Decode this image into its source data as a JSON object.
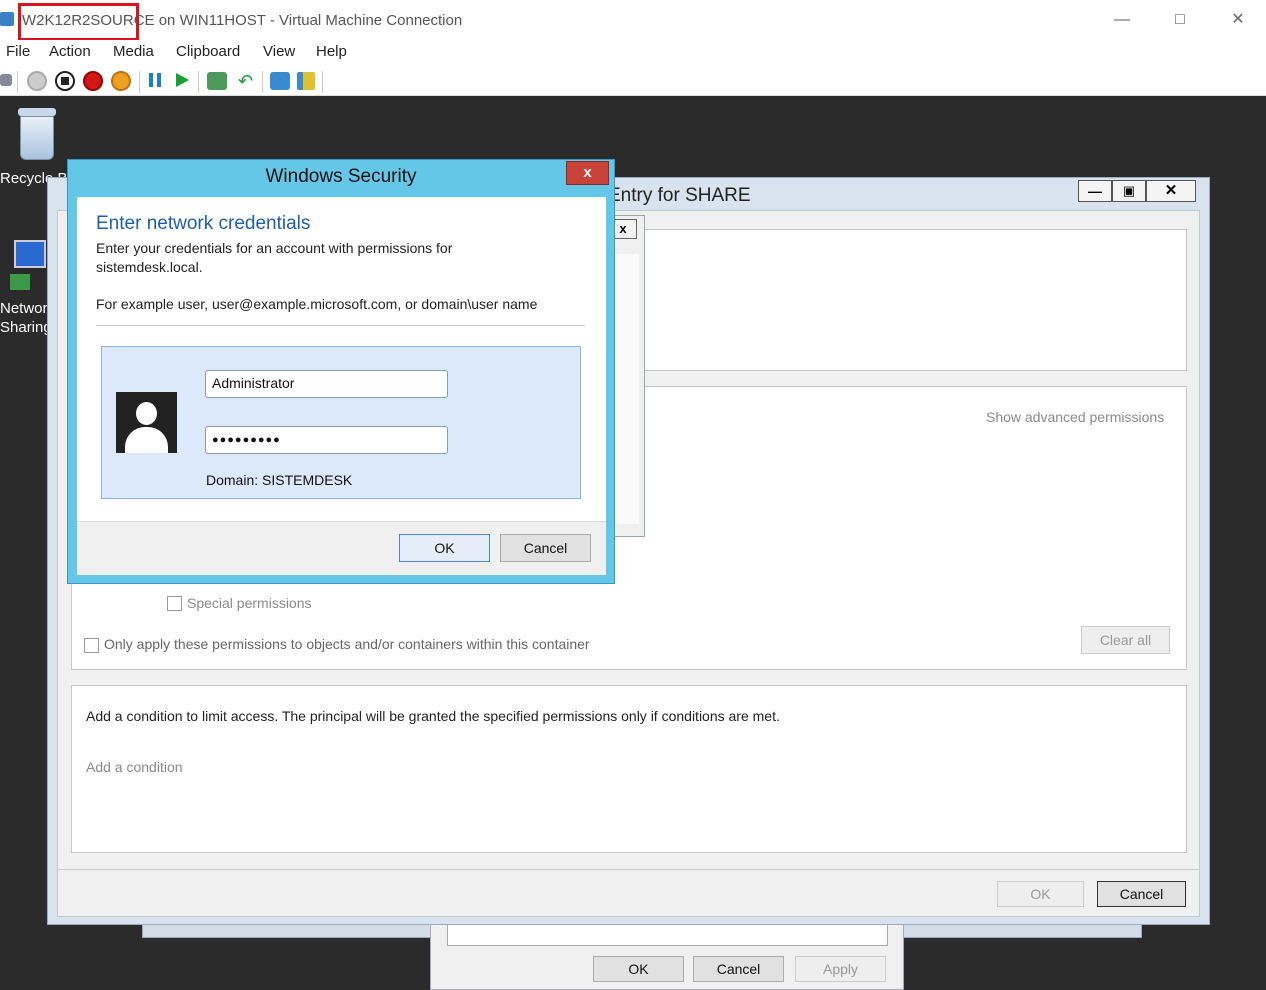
{
  "window": {
    "vm_name": "W2K12R2SOURCE",
    "title_rest": " on WIN11HOST - Virtual Machine Connection"
  },
  "menu": [
    "File",
    "Action",
    "Media",
    "Clipboard",
    "View",
    "Help"
  ],
  "toolbar_icons": [
    "ctrl-alt-del-icon",
    "start-icon",
    "turn-off-icon",
    "shutdown-icon",
    "save-icon",
    "pause-icon",
    "resume-icon",
    "checkpoint-icon",
    "revert-icon",
    "enhanced-session-icon",
    "share-icon"
  ],
  "desktop": {
    "recycle": "Recycle Bi",
    "network_line1": "Network",
    "network_line2": "Sharing"
  },
  "perm": {
    "title": "Entry for SHARE",
    "show_advanced": "Show advanced permissions",
    "special": "Special permissions",
    "only_apply": "Only apply these permissions to objects and/or containers within this container",
    "clear_all": "Clear all",
    "condition_text": "Add a condition to limit access. The principal will be granted the specified permissions only if conditions are met.",
    "add_condition": "Add a condition",
    "ok": "OK",
    "cancel": "Cancel"
  },
  "bottom": {
    "ok": "OK",
    "cancel": "Cancel",
    "apply": "Apply"
  },
  "security": {
    "title": "Windows Security",
    "close": "x",
    "heading": "Enter network credentials",
    "desc1": "Enter your credentials for an account with permissions for",
    "desc2": "sistemdesk.local.",
    "example": "For example user, user@example.microsoft.com, or domain\\user name",
    "username": "Administrator",
    "password": "●●●●●●●●●",
    "domain": "Domain: SISTEMDESK",
    "ok": "OK",
    "cancel": "Cancel"
  },
  "colors": {
    "accent": "#65c7e8",
    "highlight": "#d9141c",
    "link": "#1e5fa8"
  }
}
